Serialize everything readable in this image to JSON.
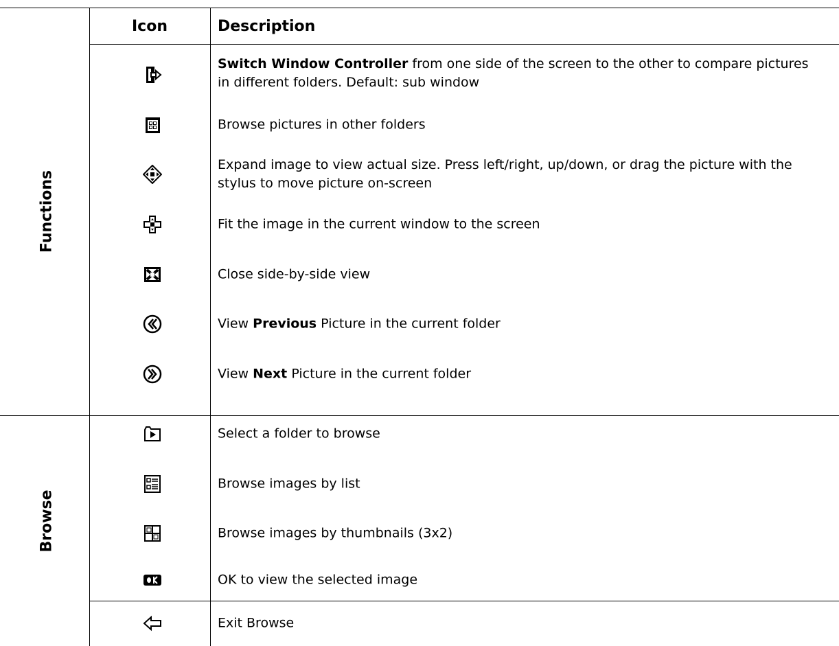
{
  "header": {
    "icon_col": "Icon",
    "desc_col": "Description"
  },
  "groups": {
    "functions": "Functions",
    "browse": "Browse"
  },
  "rows": [
    {
      "icon": "switch-window-icon",
      "parts": [
        {
          "t": "Switch Window Controller",
          "b": true
        },
        {
          "t": " from one side of the screen to the other to compare pictures in different folders. Default: sub window",
          "b": false
        }
      ]
    },
    {
      "icon": "browse-folders-icon",
      "parts": [
        {
          "t": "Browse pictures in other folders",
          "b": false
        }
      ]
    },
    {
      "icon": "expand-actual-size-icon",
      "parts": [
        {
          "t": "Expand image to view actual size. Press left/right, up/down, or drag the picture with the stylus to move picture on-screen",
          "b": false
        }
      ]
    },
    {
      "icon": "fit-to-screen-icon",
      "parts": [
        {
          "t": "Fit the image in the current window to the screen",
          "b": false
        }
      ]
    },
    {
      "icon": "close-side-by-side-icon",
      "parts": [
        {
          "t": "Close side-by-side view",
          "b": false
        }
      ]
    },
    {
      "icon": "previous-picture-icon",
      "parts": [
        {
          "t": "View ",
          "b": false
        },
        {
          "t": "Previous",
          "b": true
        },
        {
          "t": " Picture in the current folder",
          "b": false
        }
      ]
    },
    {
      "icon": "next-picture-icon",
      "parts": [
        {
          "t": "View ",
          "b": false
        },
        {
          "t": "Next",
          "b": true
        },
        {
          "t": " Picture in the current folder",
          "b": false
        }
      ]
    },
    {
      "icon": "select-folder-icon",
      "parts": [
        {
          "t": "Select a folder to browse",
          "b": false
        }
      ]
    },
    {
      "icon": "browse-list-icon",
      "parts": [
        {
          "t": "Browse images by list",
          "b": false
        }
      ]
    },
    {
      "icon": "browse-thumbnails-icon",
      "parts": [
        {
          "t": "Browse images by thumbnails (3x2)",
          "b": false
        }
      ]
    },
    {
      "icon": "ok-icon",
      "parts": [
        {
          "t": "OK to view the selected image",
          "b": false
        }
      ]
    },
    {
      "icon": "exit-browse-icon",
      "parts": [
        {
          "t": "Exit Browse",
          "b": false
        }
      ]
    }
  ]
}
